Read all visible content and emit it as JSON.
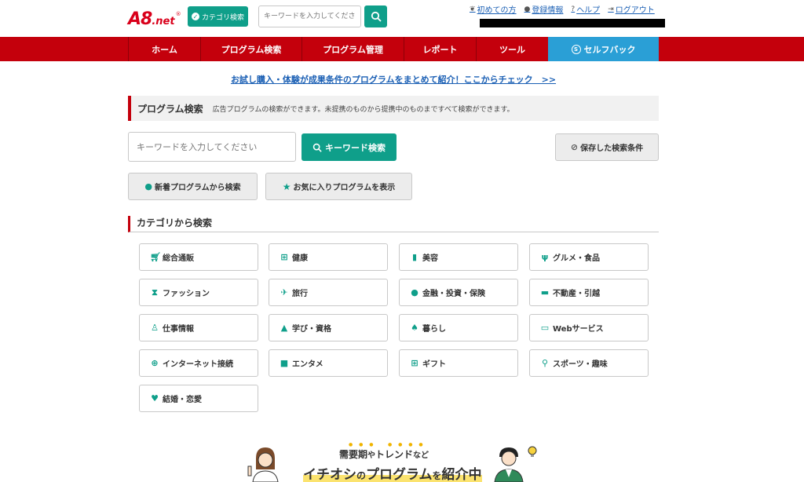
{
  "header": {
    "logo_main": "A8",
    "logo_net": ".net",
    "logo_reg": "®",
    "category_button": "カテゴリ検索",
    "search_placeholder": "キーワードを入力してください",
    "links": [
      {
        "icon": "leaf-icon",
        "label": "初めての方"
      },
      {
        "icon": "user-icon",
        "label": "登録情報"
      },
      {
        "icon": "help-icon",
        "label": "ヘルプ"
      },
      {
        "icon": "logout-icon",
        "label": "ログアウト"
      }
    ]
  },
  "nav": {
    "items": [
      "ホーム",
      "プログラム検索",
      "プログラム管理",
      "レポート",
      "ツール"
    ],
    "self_back": "セルフバック"
  },
  "promo_link": "お試し購入・体験が成果条件のプログラムをまとめて紹介！ここからチェック　>>",
  "program_search": {
    "title": "プログラム検索",
    "description": "広告プログラムの検索ができます。未提携のものから提携中のものまですべて検索ができます。",
    "keyword_placeholder": "キーワードを入力してください",
    "keyword_button": "キーワード検索",
    "saved_button": "保存した検索条件",
    "new_button": "新着プログラムから検索",
    "favorite_button": "お気に入りプログラムを表示"
  },
  "category": {
    "title": "カテゴリから検索",
    "items": [
      {
        "label": "総合通販",
        "icon": "cart-icon"
      },
      {
        "label": "健康",
        "icon": "medical-box-icon"
      },
      {
        "label": "美容",
        "icon": "bottle-icon"
      },
      {
        "label": "グルメ・食品",
        "icon": "cutlery-icon"
      },
      {
        "label": "ファッション",
        "icon": "dress-icon"
      },
      {
        "label": "旅行",
        "icon": "airplane-icon"
      },
      {
        "label": "金融・投資・保険",
        "icon": "money-bag-icon"
      },
      {
        "label": "不動産・引越",
        "icon": "truck-icon"
      },
      {
        "label": "仕事情報",
        "icon": "worker-icon"
      },
      {
        "label": "学び・資格",
        "icon": "graduation-cap-icon"
      },
      {
        "label": "暮らし",
        "icon": "tree-icon"
      },
      {
        "label": "Webサービス",
        "icon": "monitor-icon"
      },
      {
        "label": "インターネット接続",
        "icon": "globe-icon"
      },
      {
        "label": "エンタメ",
        "icon": "camera-icon"
      },
      {
        "label": "ギフト",
        "icon": "gift-icon"
      },
      {
        "label": "スポーツ・趣味",
        "icon": "racket-icon"
      },
      {
        "label": "結婚・恋愛",
        "icon": "heart-icon"
      }
    ]
  },
  "banner": {
    "line1_a": "需要期",
    "line1_b": "や",
    "line1_c": "トレンド",
    "line1_d": "など",
    "line2_a": "イチオシ",
    "line2_b": "の",
    "line2_c": "プログラム",
    "line2_d": "を",
    "line2_e": "紹介中"
  },
  "colors": {
    "brand_red": "#c4000c",
    "teal": "#0f9f8a",
    "selfback_blue": "#2a9fd6",
    "link_blue": "#1a5fb4"
  }
}
